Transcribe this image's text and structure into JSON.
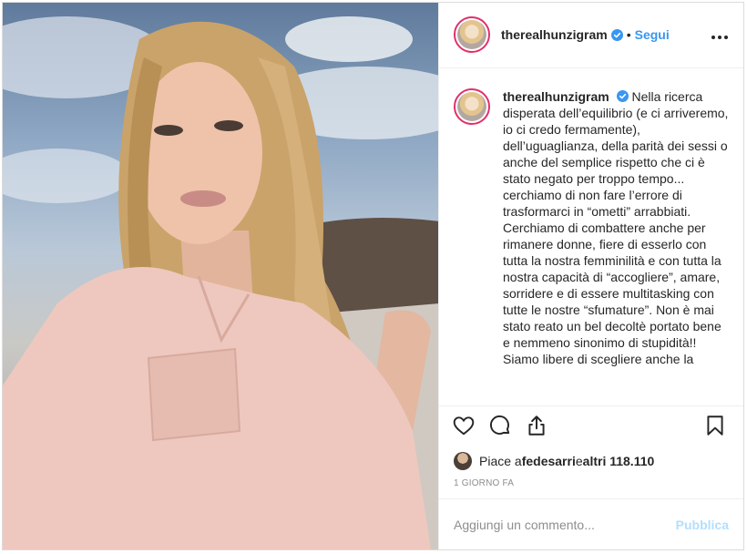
{
  "post": {
    "author": {
      "username": "therealhunzigram",
      "verified": true,
      "follow_label": "Segui",
      "dot": "•"
    },
    "caption": {
      "username": "therealhunzigram",
      "text": "Nella ricerca disperata dell’equilibrio (e ci arriveremo, io ci credo fermamente), dell’uguaglianza, della parità dei sessi o anche del semplice rispetto che ci è stato negato per troppo tempo... cerchiamo di non fare l’errore di trasformarci in “ometti” arrabbiati. Cerchiamo di combattere anche per rimanere donne, fiere di esserlo con tutta la nostra femminilità e con tutta la nostra capacità di “accogliere”, amare, sorridere e di essere multitasking con tutte le nostre “sfumature”. Non è mai stato reato un bel decoltè portato bene e nemmeno sinonimo di stupidità!!\nSiamo libere di scegliere anche la"
    },
    "likes": {
      "prefix": "Piace a ",
      "user": "fedesarri",
      "middle": " e ",
      "others": "altri 118.110"
    },
    "timestamp": "1 GIORNO FA",
    "comment_box": {
      "placeholder": "Aggiungi un commento...",
      "publish_label": "Pubblica"
    }
  },
  "colors": {
    "accent": "#3897f0",
    "publish_disabled": "#b2dffc",
    "meta_text": "#8e8e8e",
    "story_ring": "#e1306c"
  },
  "icons": [
    "verified-badge-icon",
    "more-options-icon",
    "heart-icon",
    "comment-icon",
    "share-icon",
    "bookmark-icon"
  ]
}
